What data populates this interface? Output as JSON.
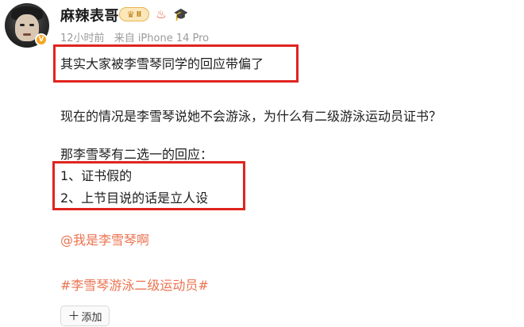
{
  "post": {
    "username": "麻辣表哥",
    "vip_badge": "Ⅱ",
    "time": "12小时前",
    "source": "来自 iPhone 14 Pro",
    "lines": [
      "其实大家被李雪琴同学的回应带偏了",
      "现在的情况是李雪琴说她不会游泳，为什么有二级游泳运动员证书？",
      "那李雪琴有二选一的回应：",
      "1、证书假的",
      "2、上节目说的话是立人设"
    ],
    "mention": "@我是李雪琴啊",
    "hashtag": "#李雪琴游泳二级运动员#",
    "add_button": "添加",
    "add_icon": "＋",
    "verified_mark": "V"
  },
  "colors": {
    "link": "#eb7350",
    "highlight_box": "#e0241f",
    "meta": "#9a9a9a"
  },
  "icons": [
    "avatar",
    "verified-icon",
    "vip-crown-icon",
    "fire-icon",
    "graduation-cap-icon",
    "plus-icon"
  ]
}
